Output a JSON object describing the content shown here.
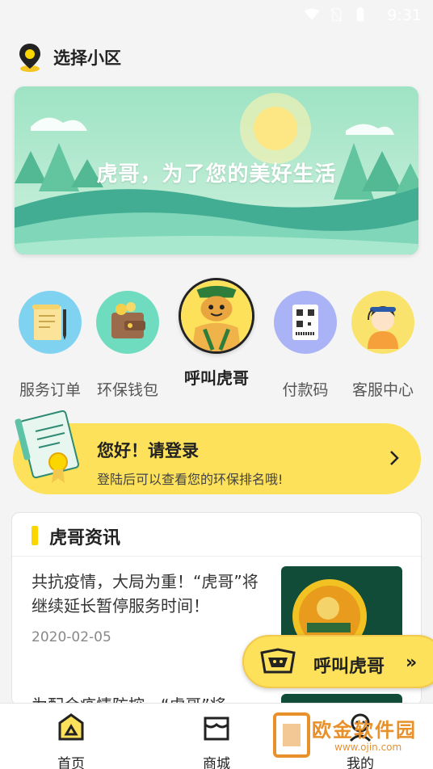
{
  "status_bar": {
    "time": "9:31"
  },
  "location": {
    "label": "选择小区"
  },
  "banner": {
    "slogan": "虎哥，为了您的美好生活"
  },
  "quick_actions": [
    {
      "label": "服务订单",
      "icon": "service-order-icon"
    },
    {
      "label": "环保钱包",
      "icon": "wallet-icon"
    },
    {
      "label": "呼叫虎哥",
      "icon": "tiger-mascot-icon"
    },
    {
      "label": "付款码",
      "icon": "qr-code-icon"
    },
    {
      "label": "客服中心",
      "icon": "customer-service-icon"
    }
  ],
  "login_card": {
    "title": "您好！请登录",
    "subtitle": "登陆后可以查看您的环保排名哦!"
  },
  "news": {
    "section_title": "虎哥资讯",
    "articles": [
      {
        "title": "共抗疫情，大局为重！“虎哥”将继续延长暂停服务时间！",
        "date": "2020-02-05"
      },
      {
        "title": "为配合疫情防控，“虎哥”将"
      }
    ]
  },
  "fab": {
    "label": "呼叫虎哥",
    "arrow": "»"
  },
  "tabbar": [
    {
      "label": "首页",
      "active": true
    },
    {
      "label": "商城"
    },
    {
      "label": "我的"
    }
  ],
  "watermark": {
    "text": "欧金软件园",
    "url": "www.ojin.com"
  },
  "colors": {
    "accent": "#fde15a",
    "accent_dark": "#fbd600",
    "banner_green": "#5fc9a4",
    "text": "#333333"
  }
}
